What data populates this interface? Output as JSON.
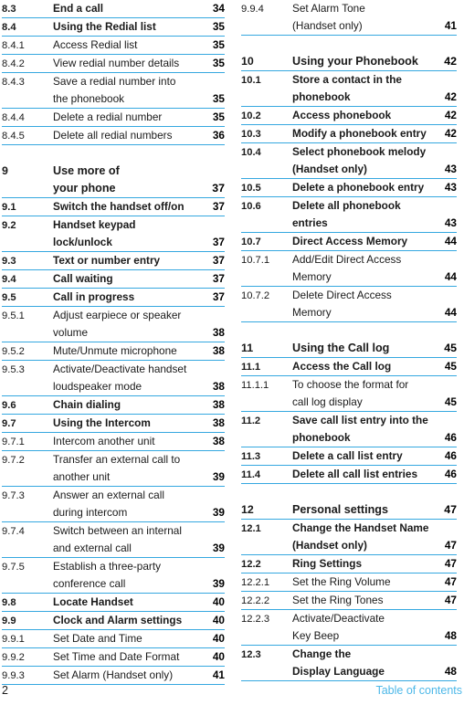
{
  "document": {
    "type": "table-of-contents",
    "footer_page_number": "2",
    "footer_label": "Table of contents",
    "rule_color": "#35a8e0",
    "footer_label_color": "#4db8e8"
  },
  "left_column": [
    {
      "num": "8.3",
      "lines": [
        "End a call"
      ],
      "page": "34",
      "bold": true,
      "chapter": false
    },
    {
      "num": "8.4",
      "lines": [
        "Using the Redial list"
      ],
      "page": "35",
      "bold": true,
      "chapter": false
    },
    {
      "num": "8.4.1",
      "lines": [
        "Access Redial list"
      ],
      "page": "35",
      "bold": false,
      "chapter": false
    },
    {
      "num": "8.4.2",
      "lines": [
        "View redial number details"
      ],
      "page": "35",
      "bold": false,
      "chapter": false
    },
    {
      "num": "8.4.3",
      "lines": [
        "Save a redial number into",
        "the phonebook"
      ],
      "page": "35",
      "bold": false,
      "chapter": false
    },
    {
      "num": "8.4.4",
      "lines": [
        "Delete a redial number"
      ],
      "page": "35",
      "bold": false,
      "chapter": false
    },
    {
      "num": "8.4.5",
      "lines": [
        "Delete all redial numbers"
      ],
      "page": "36",
      "bold": false,
      "chapter": false
    },
    {
      "gap": true
    },
    {
      "num": "9",
      "lines": [
        "Use more of",
        "your phone"
      ],
      "page": "37",
      "bold": true,
      "chapter": true
    },
    {
      "num": "9.1",
      "lines": [
        "Switch the handset off/on"
      ],
      "page": "37",
      "bold": true,
      "chapter": false
    },
    {
      "num": "9.2",
      "lines": [
        "Handset keypad",
        "lock/unlock"
      ],
      "page": "37",
      "bold": true,
      "chapter": false
    },
    {
      "num": "9.3",
      "lines": [
        "Text or number entry"
      ],
      "page": "37",
      "bold": true,
      "chapter": false
    },
    {
      "num": "9.4",
      "lines": [
        "Call waiting"
      ],
      "page": "37",
      "bold": true,
      "chapter": false
    },
    {
      "num": "9.5",
      "lines": [
        "Call in progress"
      ],
      "page": "37",
      "bold": true,
      "chapter": false
    },
    {
      "num": "9.5.1",
      "lines": [
        "Adjust earpiece or speaker",
        "volume"
      ],
      "page": "38",
      "bold": false,
      "chapter": false
    },
    {
      "num": "9.5.2",
      "lines": [
        "Mute/Unmute microphone"
      ],
      "page": "38",
      "bold": false,
      "chapter": false
    },
    {
      "num": "9.5.3",
      "lines": [
        "Activate/Deactivate handset",
        "loudspeaker mode"
      ],
      "page": "38",
      "bold": false,
      "chapter": false
    },
    {
      "num": "9.6",
      "lines": [
        "Chain dialing"
      ],
      "page": "38",
      "bold": true,
      "chapter": false
    },
    {
      "num": "9.7",
      "lines": [
        "Using the Intercom"
      ],
      "page": "38",
      "bold": true,
      "chapter": false
    },
    {
      "num": "9.7.1",
      "lines": [
        "Intercom another unit"
      ],
      "page": "38",
      "bold": false,
      "chapter": false
    },
    {
      "num": "9.7.2",
      "lines": [
        "Transfer an external call to",
        "another unit"
      ],
      "page": "39",
      "bold": false,
      "chapter": false
    },
    {
      "num": "9.7.3",
      "lines": [
        "Answer an external call",
        "during intercom"
      ],
      "page": "39",
      "bold": false,
      "chapter": false
    },
    {
      "num": "9.7.4",
      "lines": [
        "Switch between an internal",
        "and external call"
      ],
      "page": "39",
      "bold": false,
      "chapter": false
    },
    {
      "num": "9.7.5",
      "lines": [
        "Establish a three-party",
        "conference call"
      ],
      "page": "39",
      "bold": false,
      "chapter": false
    },
    {
      "num": "9.8",
      "lines": [
        "Locate Handset"
      ],
      "page": "40",
      "bold": true,
      "chapter": false
    },
    {
      "num": "9.9",
      "lines": [
        "Clock and Alarm settings"
      ],
      "page": "40",
      "bold": true,
      "chapter": false
    },
    {
      "num": "9.9.1",
      "lines": [
        "Set Date and Time"
      ],
      "page": "40",
      "bold": false,
      "chapter": false
    },
    {
      "num": "9.9.2",
      "lines": [
        "Set Time and Date Format"
      ],
      "page": "40",
      "bold": false,
      "chapter": false
    },
    {
      "num": "9.9.3",
      "lines": [
        "Set Alarm (Handset only)"
      ],
      "page": "41",
      "bold": false,
      "chapter": false
    }
  ],
  "right_column": [
    {
      "num": "9.9.4",
      "lines": [
        "Set Alarm Tone",
        "(Handset only)"
      ],
      "page": "41",
      "bold": false,
      "chapter": false
    },
    {
      "gap": true
    },
    {
      "num": "10",
      "lines": [
        "Using your Phonebook"
      ],
      "page": "42",
      "bold": true,
      "chapter": true
    },
    {
      "num": "10.1",
      "lines": [
        "Store a contact in the",
        "phonebook"
      ],
      "page": "42",
      "bold": true,
      "chapter": false
    },
    {
      "num": "10.2",
      "lines": [
        "Access phonebook"
      ],
      "page": "42",
      "bold": true,
      "chapter": false
    },
    {
      "num": "10.3",
      "lines": [
        "Modify a phonebook entry"
      ],
      "page": "42",
      "bold": true,
      "chapter": false
    },
    {
      "num": "10.4",
      "lines": [
        "Select phonebook melody",
        "(Handset only)"
      ],
      "page": "43",
      "bold": true,
      "chapter": false
    },
    {
      "num": "10.5",
      "lines": [
        "Delete a phonebook entry"
      ],
      "page": "43",
      "bold": true,
      "chapter": false
    },
    {
      "num": "10.6",
      "lines": [
        "Delete all phonebook",
        "entries"
      ],
      "page": "43",
      "bold": true,
      "chapter": false
    },
    {
      "num": "10.7",
      "lines": [
        "Direct Access Memory"
      ],
      "page": "44",
      "bold": true,
      "chapter": false
    },
    {
      "num": "10.7.1",
      "lines": [
        "Add/Edit Direct Access",
        "Memory"
      ],
      "page": "44",
      "bold": false,
      "chapter": false
    },
    {
      "num": "10.7.2",
      "lines": [
        "Delete Direct Access",
        "Memory"
      ],
      "page": "44",
      "bold": false,
      "chapter": false
    },
    {
      "gap": true
    },
    {
      "num": "11",
      "lines": [
        "Using the Call log"
      ],
      "page": "45",
      "bold": true,
      "chapter": true
    },
    {
      "num": "11.1",
      "lines": [
        "Access the Call log"
      ],
      "page": "45",
      "bold": true,
      "chapter": false
    },
    {
      "num": "11.1.1",
      "lines": [
        "To choose the format for",
        "call log display"
      ],
      "page": "45",
      "bold": false,
      "chapter": false
    },
    {
      "num": "11.2",
      "lines": [
        "Save call list entry into the",
        "phonebook"
      ],
      "page": "46",
      "bold": true,
      "chapter": false
    },
    {
      "num": "11.3",
      "lines": [
        "Delete a call list entry"
      ],
      "page": "46",
      "bold": true,
      "chapter": false
    },
    {
      "num": "11.4",
      "lines": [
        "Delete all call list entries"
      ],
      "page": "46",
      "bold": true,
      "chapter": false
    },
    {
      "gap": true
    },
    {
      "num": "12",
      "lines": [
        "Personal settings"
      ],
      "page": "47",
      "bold": true,
      "chapter": true
    },
    {
      "num": "12.1",
      "lines": [
        "Change the Handset Name",
        "(Handset only)"
      ],
      "page": "47",
      "bold": true,
      "chapter": false
    },
    {
      "num": "12.2",
      "lines": [
        "Ring Settings"
      ],
      "page": "47",
      "bold": true,
      "chapter": false
    },
    {
      "num": "12.2.1",
      "lines": [
        "Set the Ring Volume"
      ],
      "page": "47",
      "bold": false,
      "chapter": false
    },
    {
      "num": "12.2.2",
      "lines": [
        "Set the Ring Tones"
      ],
      "page": "47",
      "bold": false,
      "chapter": false
    },
    {
      "num": "12.2.3",
      "lines": [
        "Activate/Deactivate",
        "Key Beep"
      ],
      "page": "48",
      "bold": false,
      "chapter": false
    },
    {
      "num": "12.3",
      "lines": [
        "Change the",
        "Display Language"
      ],
      "page": "48",
      "bold": true,
      "chapter": false
    }
  ]
}
